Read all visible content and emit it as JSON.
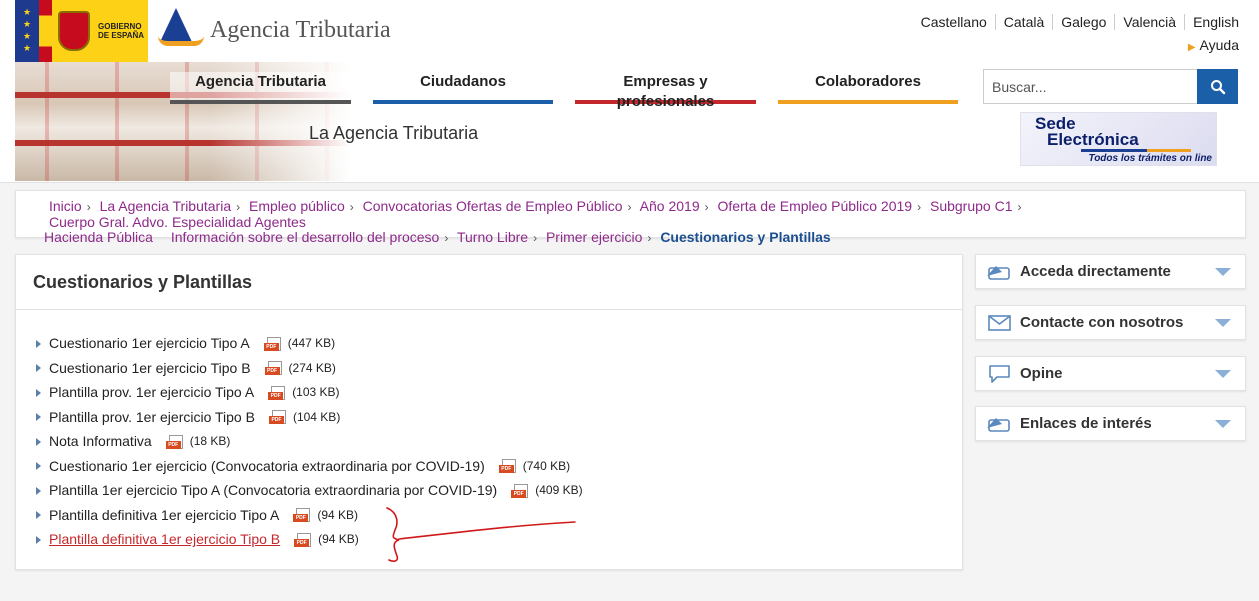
{
  "header": {
    "gov_logo_text": "GOBIERNO DE ESPAÑA",
    "agency_name": "Agencia Tributaria",
    "languages": [
      "Castellano",
      "Català",
      "Galego",
      "Valencià",
      "English"
    ],
    "help_label": "Ayuda",
    "banner_title": "La Agencia Tributaria",
    "nav": [
      "Agencia Tributaria",
      "Ciudadanos",
      "Empresas y profesionales",
      "Colaboradores"
    ],
    "search": {
      "placeholder": "Buscar...",
      "icon": "search-icon"
    },
    "sede": {
      "line1": "Sede",
      "line2": "Electrónica",
      "tagline": "Todos los trámites on line"
    }
  },
  "colors": {
    "nav_agencia": "#555555",
    "nav_ciudadanos": "#1b5fa8",
    "nav_empresas": "#c5282c",
    "nav_colaboradores": "#f0a020",
    "breadcrumb_link": "#8e2a8b",
    "breadcrumb_current": "#1b4f8f",
    "visited_link": "#c5282c"
  },
  "breadcrumb": {
    "items": [
      "Inicio",
      "La Agencia Tributaria",
      "Empleo público",
      "Convocatorias Ofertas de Empleo Público",
      "Año 2019",
      "Oferta de Empleo Público 2019",
      "Subgrupo C1",
      "Cuerpo Gral. Advo. Especialidad Agentes Hacienda Pública",
      "Información sobre el desarrollo del proceso",
      "Turno Libre",
      "Primer ejercicio"
    ],
    "item_line1_part": "Cuerpo Gral. Advo. Especialidad Agentes",
    "item_line2_part": "Hacienda Pública",
    "current": "Cuestionarios y Plantillas"
  },
  "main": {
    "title": "Cuestionarios y Plantillas",
    "documents": [
      {
        "label": "Cuestionario 1er ejercicio Tipo A",
        "size": "(447 KB)",
        "icon": "pdf-icon",
        "visited": false
      },
      {
        "label": "Cuestionario 1er ejercicio Tipo B",
        "size": "(274 KB)",
        "icon": "pdf-icon",
        "visited": false
      },
      {
        "label": "Plantilla prov. 1er ejercicio Tipo A",
        "size": "(103 KB)",
        "icon": "pdf-icon",
        "visited": false
      },
      {
        "label": "Plantilla prov. 1er ejercicio Tipo B",
        "size": "(104 KB)",
        "icon": "pdf-icon",
        "visited": false
      },
      {
        "label": "Nota Informativa",
        "size": "(18 KB)",
        "icon": "pdf-icon",
        "visited": false
      },
      {
        "label": "Cuestionario 1er ejercicio (Convocatoria extraordinaria por COVID-19)",
        "size": "(740 KB)",
        "icon": "pdf-icon",
        "visited": false
      },
      {
        "label": "Plantilla 1er ejercicio Tipo A (Convocatoria extraordinaria por COVID-19)",
        "size": "(409 KB)",
        "icon": "pdf-icon",
        "visited": false
      },
      {
        "label": "Plantilla definitiva 1er ejercicio Tipo A",
        "size": "(94 KB)",
        "icon": "pdf-icon",
        "visited": false
      },
      {
        "label": "Plantilla definitiva 1er ejercicio Tipo B",
        "size": "(94 KB)",
        "icon": "pdf-icon",
        "visited": true
      }
    ]
  },
  "sidebar": {
    "items": [
      {
        "label": "Acceda directamente",
        "icon": "direct-access-icon"
      },
      {
        "label": "Contacte con nosotros",
        "icon": "envelope-icon"
      },
      {
        "label": "Opine",
        "icon": "speech-bubble-icon"
      },
      {
        "label": "Enlaces de interés",
        "icon": "links-icon"
      }
    ]
  }
}
